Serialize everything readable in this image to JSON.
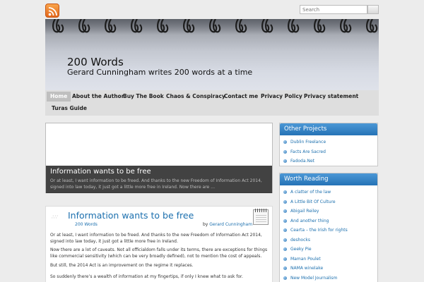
{
  "topbar": {
    "search": {
      "placeholder": "Search"
    }
  },
  "header": {
    "site_title": "200 Words",
    "site_description": "Gerard Cunningham writes 200 words at a time"
  },
  "nav": {
    "items": [
      {
        "label": "Home",
        "active": true
      },
      {
        "label": "About the Author"
      },
      {
        "label": "Buy The Book"
      },
      {
        "label": "Chaos & Conspiracy"
      },
      {
        "label": "Contact me"
      },
      {
        "label": "Privacy Policy"
      },
      {
        "label": "Privacy statement"
      },
      {
        "label": "Turas Guide"
      }
    ]
  },
  "feature": {
    "title": "Information wants to be free",
    "excerpt": "Or at least, I want information to be freed. And thanks to the new Freedom of Information Act 2014, signed into law today, it just got a little more free in Ireland. Now there are …"
  },
  "post": {
    "title": "Information wants to be free",
    "category": "200 Words",
    "byline_prefix": "by",
    "author": "Gerard Cunningham",
    "paragraphs": [
      "Or at least, I want information to be freed. And thanks to the new Freedom of Information Act 2014, signed into law today, it just got a little more free in Ireland.",
      "Now there are a lot of caveats. Not all officialdom falls under its terms, there are exceptions for things like commercial sensitivity (which can be very broadly defined), not to mention the cost of appeals.",
      "But still, the 2014 Act is an improvement on the regime it replaces.",
      "So suddenly there’s a wealth of information at my fingertips, if only I knew what to ask for."
    ]
  },
  "sidebar": {
    "other_projects": {
      "title": "Other Projects",
      "items": [
        "Dublin Freelance",
        "Facts Are Sacred",
        "Fadoda.Net"
      ]
    },
    "worth_reading": {
      "title": "Worth Reading",
      "items": [
        "A clatter of the law",
        "A Little Bit Of Culture",
        "Abigail Reiley",
        "And another thing",
        "Cearta – the Irish for rights",
        "deshocks",
        "Geeky Pie",
        "Maman Poulet",
        "NAMA winelake",
        "New Model Journalism"
      ]
    }
  },
  "colors": {
    "accent": "#1b6fae",
    "widget_header": "#2f7fc1",
    "rss": "#f08a2d"
  }
}
